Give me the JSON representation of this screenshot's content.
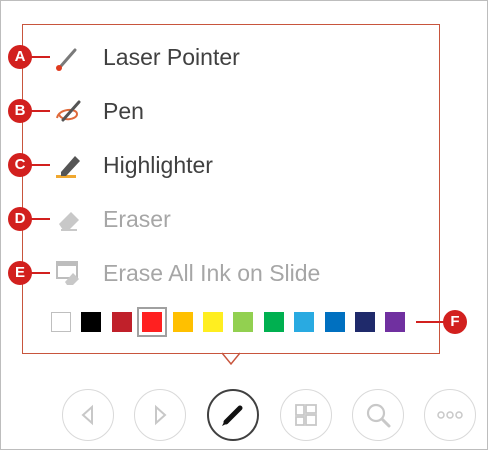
{
  "menu": {
    "items": [
      {
        "label": "Laser Pointer",
        "callout": "A",
        "enabled": true,
        "icon": "laser-pointer-icon"
      },
      {
        "label": "Pen",
        "callout": "B",
        "enabled": true,
        "icon": "pen-icon"
      },
      {
        "label": "Highlighter",
        "callout": "C",
        "enabled": true,
        "icon": "highlighter-icon"
      },
      {
        "label": "Eraser",
        "callout": "D",
        "enabled": false,
        "icon": "eraser-icon"
      },
      {
        "label": "Erase All Ink on Slide",
        "callout": "E",
        "enabled": false,
        "icon": "erase-all-icon"
      }
    ]
  },
  "colors": {
    "swatches": [
      "#ffffff",
      "#000000",
      "#c0202a",
      "#ff2020",
      "#ffc000",
      "#ffee20",
      "#92d050",
      "#00b050",
      "#29aae1",
      "#0070c0",
      "#1f2a6b",
      "#7030a0"
    ],
    "selected_index": 3,
    "callout": "F"
  },
  "toolbar": {
    "buttons": [
      {
        "icon": "previous-icon",
        "active": false
      },
      {
        "icon": "next-icon",
        "active": false
      },
      {
        "icon": "pen-tools-icon",
        "active": true
      },
      {
        "icon": "see-all-slides-icon",
        "active": false
      },
      {
        "icon": "zoom-icon",
        "active": false
      },
      {
        "icon": "more-options-icon",
        "active": false
      }
    ]
  },
  "accent_color": "#d2201e"
}
